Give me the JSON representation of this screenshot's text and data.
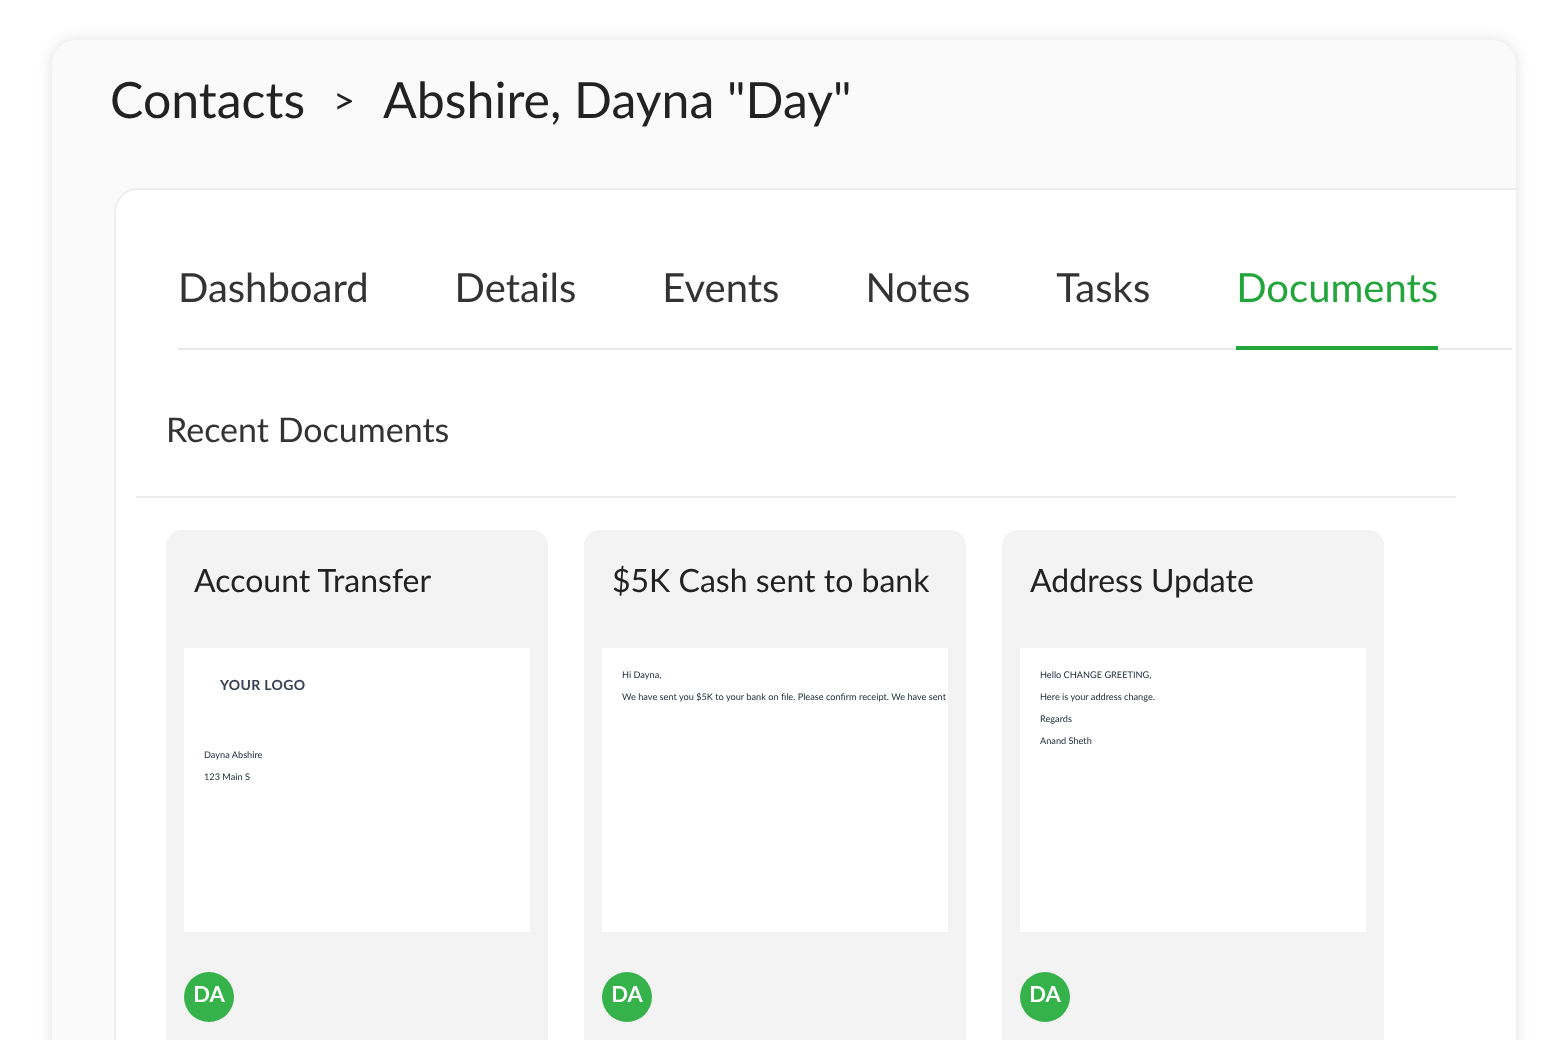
{
  "breadcrumb": {
    "parent": "Contacts",
    "separator": ">",
    "current": "Abshire, Dayna \"Day\""
  },
  "tabs": [
    {
      "label": "Dashboard",
      "selected": false
    },
    {
      "label": "Details",
      "selected": false
    },
    {
      "label": "Events",
      "selected": false
    },
    {
      "label": "Notes",
      "selected": false
    },
    {
      "label": "Tasks",
      "selected": false
    },
    {
      "label": "Documents",
      "selected": true
    }
  ],
  "section_title": "Recent Documents",
  "documents": [
    {
      "title": "Account Transfer",
      "initials": "DA",
      "preview": [
        {
          "kind": "logo",
          "text": "YOUR LOGO"
        },
        {
          "kind": "text",
          "text": "Dayna Abshire"
        },
        {
          "kind": "text",
          "text": "123 Main S"
        }
      ]
    },
    {
      "title": "$5K Cash sent to bank",
      "initials": "DA",
      "preview": [
        {
          "kind": "text",
          "text": "Hi Dayna,"
        },
        {
          "kind": "text",
          "text": "We have sent you $5K to your bank on file. Please confirm receipt. We have sent"
        }
      ]
    },
    {
      "title": "Address Update",
      "initials": "DA",
      "preview": [
        {
          "kind": "text",
          "text": "Hello CHANGE GREETING,"
        },
        {
          "kind": "text",
          "text": "Here is your address change."
        },
        {
          "kind": "text",
          "text": "Regards"
        },
        {
          "kind": "text",
          "text": "Anand Sheth"
        }
      ]
    }
  ]
}
